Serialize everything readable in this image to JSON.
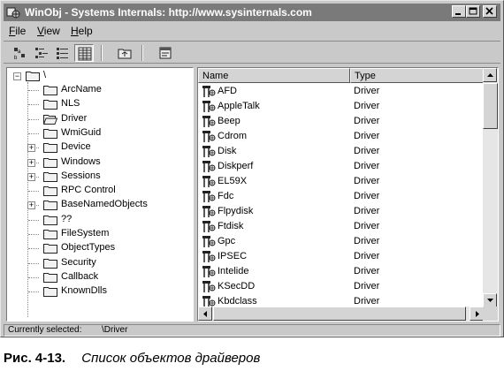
{
  "window": {
    "title": "WinObj - Systems Internals: http://www.sysinternals.com"
  },
  "menu": [
    {
      "label": "File",
      "mnemonic": "F"
    },
    {
      "label": "View",
      "mnemonic": "V"
    },
    {
      "label": "Help",
      "mnemonic": "H"
    }
  ],
  "toolbar": {
    "icons": [
      "large-icons-view",
      "small-icons-view",
      "list-view",
      "details-view",
      "up-one-level",
      "properties"
    ]
  },
  "tree": {
    "root": "\\",
    "items": [
      {
        "label": "ArcName",
        "expandable": false
      },
      {
        "label": "NLS",
        "expandable": false
      },
      {
        "label": "Driver",
        "expandable": false,
        "open": true
      },
      {
        "label": "WmiGuid",
        "expandable": false
      },
      {
        "label": "Device",
        "expandable": true
      },
      {
        "label": "Windows",
        "expandable": true
      },
      {
        "label": "Sessions",
        "expandable": true
      },
      {
        "label": "RPC Control",
        "expandable": false
      },
      {
        "label": "BaseNamedObjects",
        "expandable": true
      },
      {
        "label": "??",
        "expandable": false
      },
      {
        "label": "FileSystem",
        "expandable": false
      },
      {
        "label": "ObjectTypes",
        "expandable": false
      },
      {
        "label": "Security",
        "expandable": false
      },
      {
        "label": "Callback",
        "expandable": false
      },
      {
        "label": "KnownDlls",
        "expandable": false
      }
    ]
  },
  "list": {
    "columns": [
      "Name",
      "Type"
    ],
    "rows": [
      {
        "name": "AFD",
        "type": "Driver"
      },
      {
        "name": "AppleTalk",
        "type": "Driver"
      },
      {
        "name": "Beep",
        "type": "Driver"
      },
      {
        "name": "Cdrom",
        "type": "Driver"
      },
      {
        "name": "Disk",
        "type": "Driver"
      },
      {
        "name": "Diskperf",
        "type": "Driver"
      },
      {
        "name": "EL59X",
        "type": "Driver"
      },
      {
        "name": "Fdc",
        "type": "Driver"
      },
      {
        "name": "Flpydisk",
        "type": "Driver"
      },
      {
        "name": "Ftdisk",
        "type": "Driver"
      },
      {
        "name": "Gpc",
        "type": "Driver"
      },
      {
        "name": "IPSEC",
        "type": "Driver"
      },
      {
        "name": "Intelide",
        "type": "Driver"
      },
      {
        "name": "KSecDD",
        "type": "Driver"
      },
      {
        "name": "Kbdclass",
        "type": "Driver"
      }
    ]
  },
  "status": {
    "label": "Currently selected:",
    "value": "\\Driver"
  },
  "caption": {
    "number": "Рис. 4-13.",
    "text": "Список объектов драйверов"
  },
  "colors": {
    "title_bar": "#7a7a7a",
    "window_face": "#c9c9c9"
  }
}
